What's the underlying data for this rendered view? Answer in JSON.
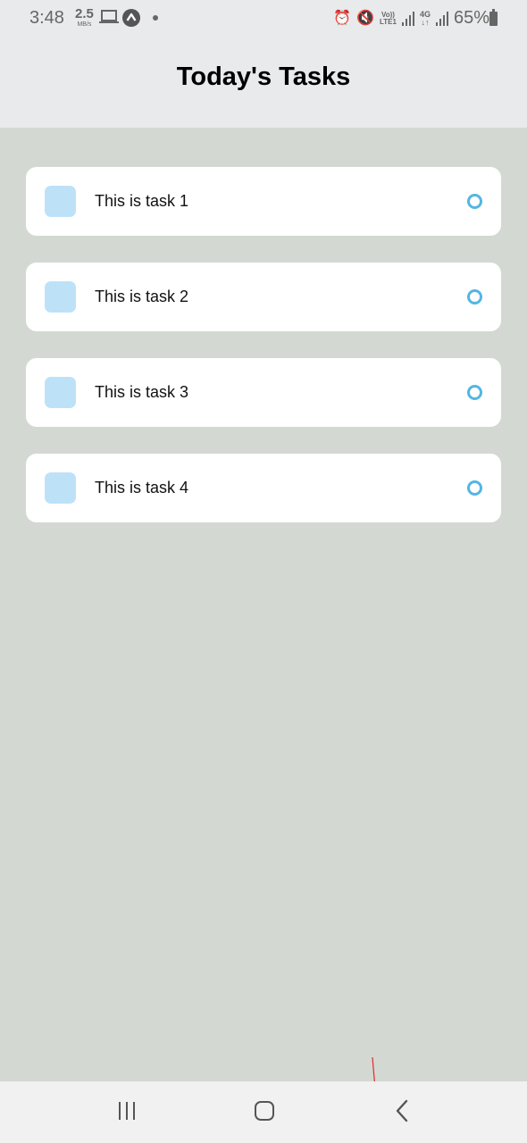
{
  "status_bar": {
    "time": "3:48",
    "net_speed_value": "2.5",
    "net_speed_unit": "MB/s",
    "volte_top": "Vo))",
    "volte_bottom": "LTE1",
    "network_type": "4G",
    "battery": "65%"
  },
  "header": {
    "title": "Today's Tasks"
  },
  "tasks": [
    {
      "label": "This is task 1"
    },
    {
      "label": "This is task 2"
    },
    {
      "label": "This is task 3"
    },
    {
      "label": "This is task 4"
    }
  ],
  "colors": {
    "background": "#d3d9d2",
    "header": "#e9eaeb",
    "card": "#ffffff",
    "task_square": "#bde2f8",
    "task_circle": "#53b6e2"
  },
  "icons": {
    "status": [
      "laptop-icon",
      "app-icon",
      "alarm-icon",
      "mute-icon",
      "signal-icon",
      "battery-icon"
    ],
    "nav": [
      "recents-icon",
      "home-icon",
      "back-icon"
    ]
  }
}
